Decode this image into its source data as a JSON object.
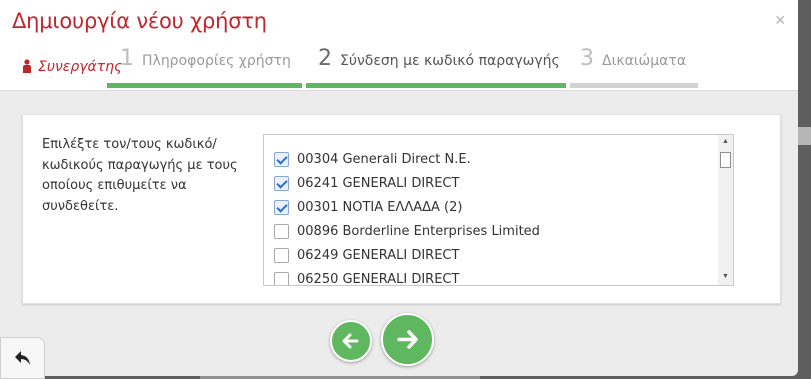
{
  "modal": {
    "title": "Δημιουργία νέου χρήστη",
    "close_symbol": "×",
    "partner_label": "Συνεργάτης"
  },
  "steps": [
    {
      "number": "1",
      "label": "Πληροφορίες χρήστη",
      "state": "done"
    },
    {
      "number": "2",
      "label": "Σύνδεση με κωδικό παραγωγής",
      "state": "active"
    },
    {
      "number": "3",
      "label": "Δικαιώματα",
      "state": "pending"
    }
  ],
  "colors": {
    "title_red": "#c0262d",
    "progress_green": "#5fb85f",
    "progress_grey": "#d2d2d2",
    "button_green": "#5fb85f"
  },
  "form": {
    "instruction": "Επιλέξτε τον/τους κωδικό/κωδικούς παραγωγής με τους οποίους επιθυμείτε να συνδεθείτε."
  },
  "codes": [
    {
      "label": "00304 Generali Direct N.E.",
      "checked": true
    },
    {
      "label": "06241 GENERALI DIRECT",
      "checked": true
    },
    {
      "label": "00301 ΝΟΤΙΑ ΕΛΛΑΔΑ (2)",
      "checked": true
    },
    {
      "label": "00896 Borderline Enterprises Limited",
      "checked": false
    },
    {
      "label": "06249 GENERALI DIRECT",
      "checked": false
    },
    {
      "label": "06250 GENERALI DIRECT",
      "checked": false
    }
  ],
  "icons": {
    "prev": "arrow-left-icon",
    "next": "arrow-right-icon",
    "back": "reply-arrow-icon",
    "partner": "user-icon"
  }
}
